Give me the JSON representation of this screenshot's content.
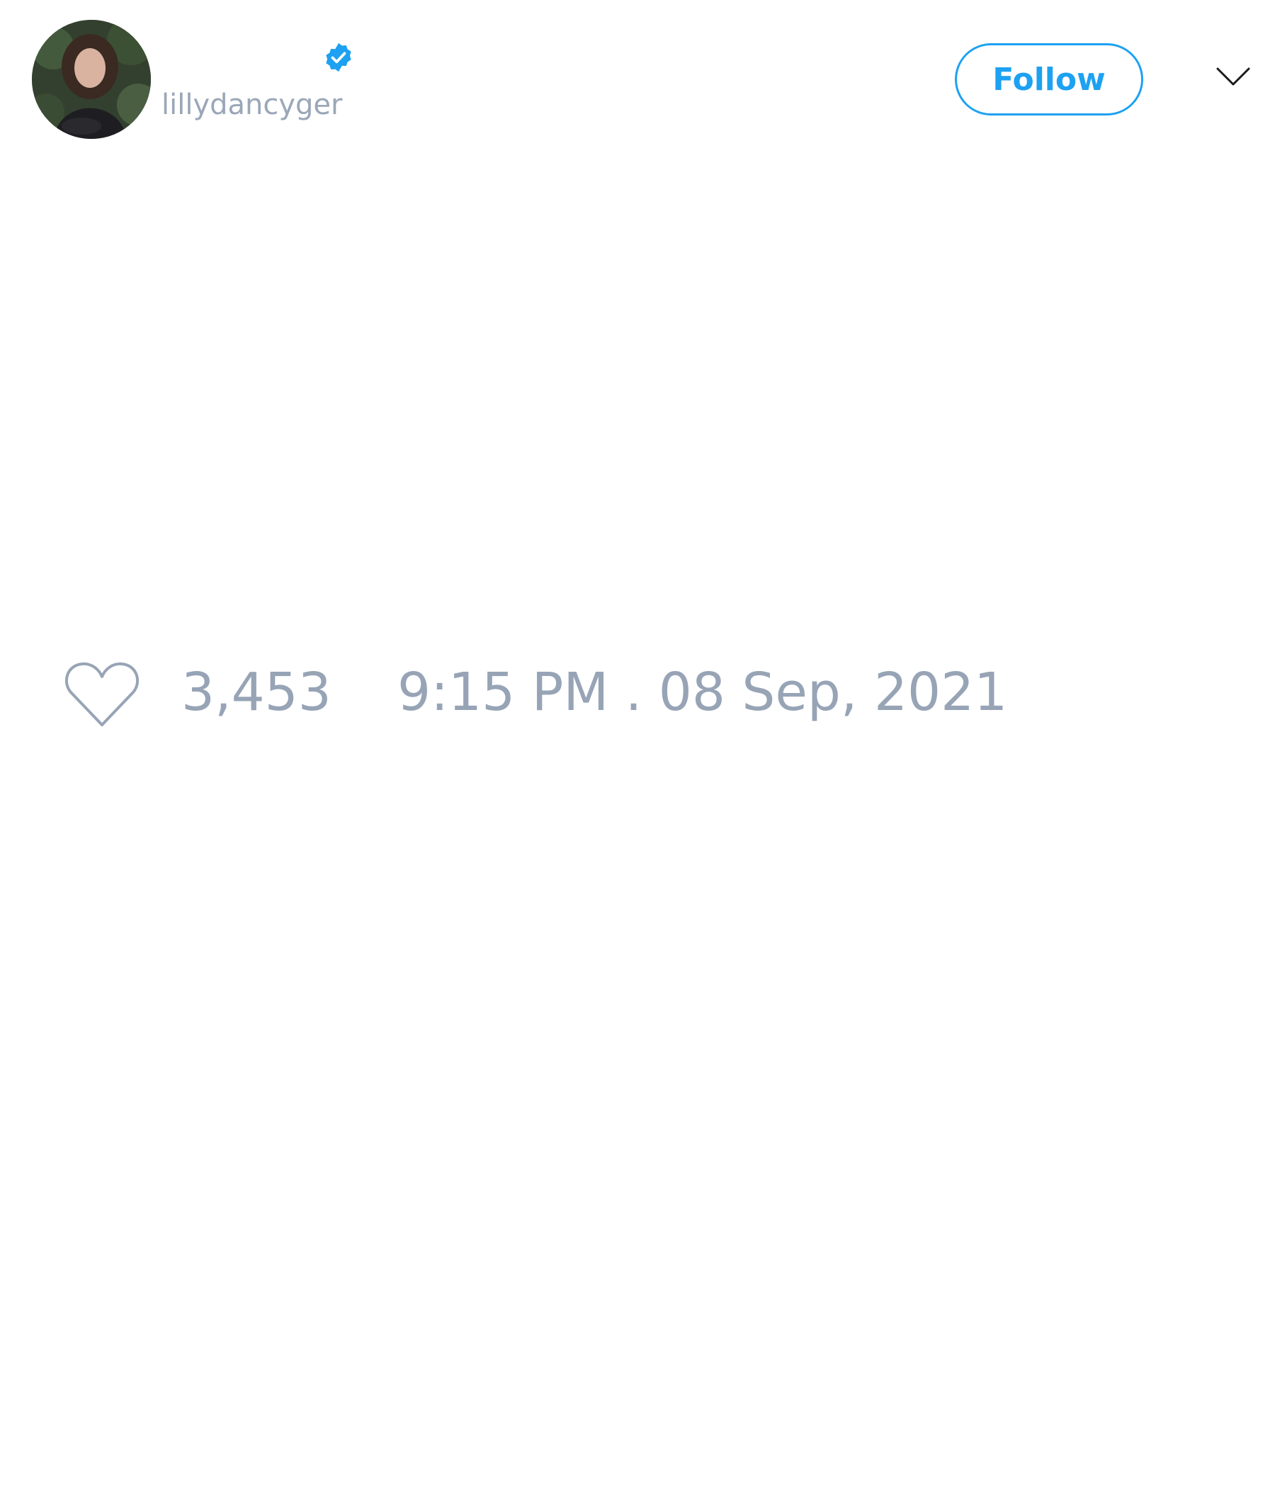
{
  "tweet": {
    "author": {
      "handle": "lillydancyger",
      "verified": true,
      "avatar": "profile-photo"
    },
    "follow_label": "Follow",
    "menu_icon": "chevron-down-icon",
    "likes": {
      "icon": "heart-icon",
      "count": "3,453"
    },
    "timestamp": "9:15 PM . 08 Sep, 2021"
  },
  "colors": {
    "accent": "#1da1f2",
    "muted_text": "#97a4b6",
    "background": "#ffffff"
  }
}
